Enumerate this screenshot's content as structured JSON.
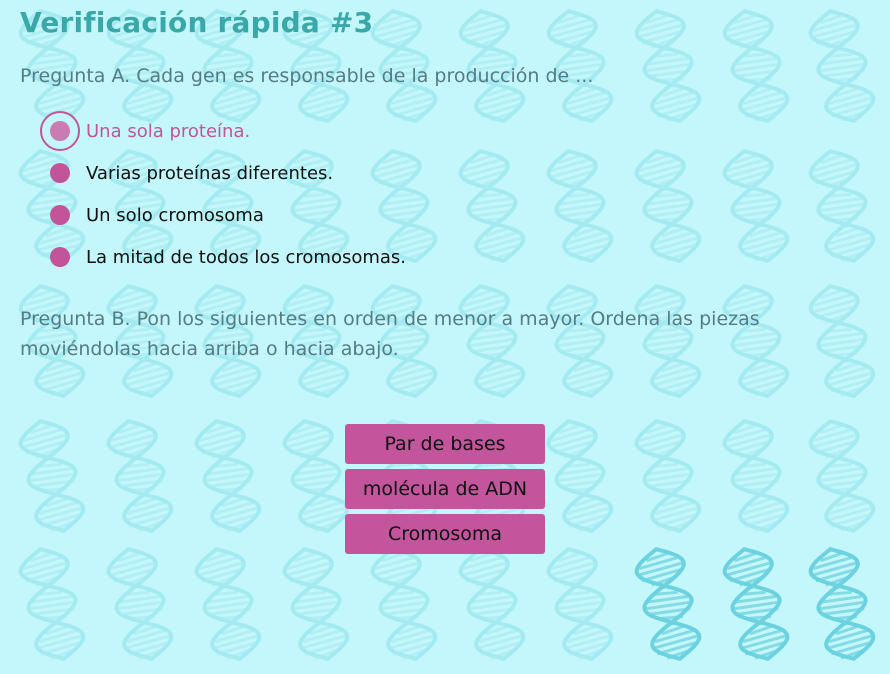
{
  "title": "Verificación rápida #3",
  "question_a": {
    "text": "Pregunta A. Cada gen es responsable de la producción de ...",
    "options": [
      {
        "label": "Una sola proteína.",
        "selected": true
      },
      {
        "label": "Varias proteínas diferentes.",
        "selected": false
      },
      {
        "label": "Un solo cromosoma",
        "selected": false
      },
      {
        "label": "La mitad de todos los cromosomas.",
        "selected": false
      }
    ]
  },
  "question_b": {
    "text": "Pregunta B. Pon los siguientes en orden de menor a mayor. Ordena las piezas moviéndolas hacia arriba o hacia abajo.",
    "pieces": [
      "Par de bases",
      "molécula de ADN",
      "Cromosoma"
    ]
  },
  "colors": {
    "background": "#c4f7fb",
    "title": "#3aa8a8",
    "accent": "#c2549a",
    "question_text": "#557b86"
  },
  "background_icon": "dna-helix-icon"
}
